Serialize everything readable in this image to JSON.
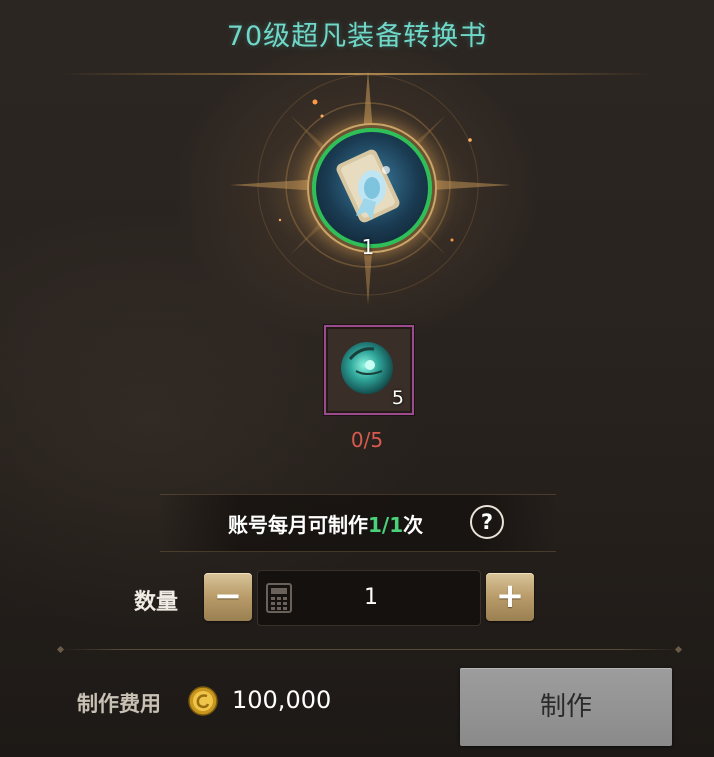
{
  "header": {
    "title": "70级超凡装备转换书"
  },
  "product": {
    "icon": "scroll-book-icon",
    "count": "1",
    "frame_color": "#2fbf58"
  },
  "material": {
    "icon": "green-orb-icon",
    "count": "5",
    "progress": "0/5",
    "progress_color": "#d85a4e"
  },
  "limit": {
    "prefix": "账号每月可制作",
    "value": "1/1",
    "suffix": "次",
    "help_label": "?"
  },
  "quantity": {
    "label": "数量",
    "minus_label": "−",
    "plus_label": "+",
    "value": "1",
    "calc_icon": "calculator-icon"
  },
  "cost": {
    "label": "制作费用",
    "currency_icon": "gold-coin-icon",
    "amount": "100,000"
  },
  "craft_button": {
    "label": "制作"
  },
  "colors": {
    "title": "#6fd8c9",
    "accent_green": "#4ad27a",
    "gold": "#b89b68"
  }
}
